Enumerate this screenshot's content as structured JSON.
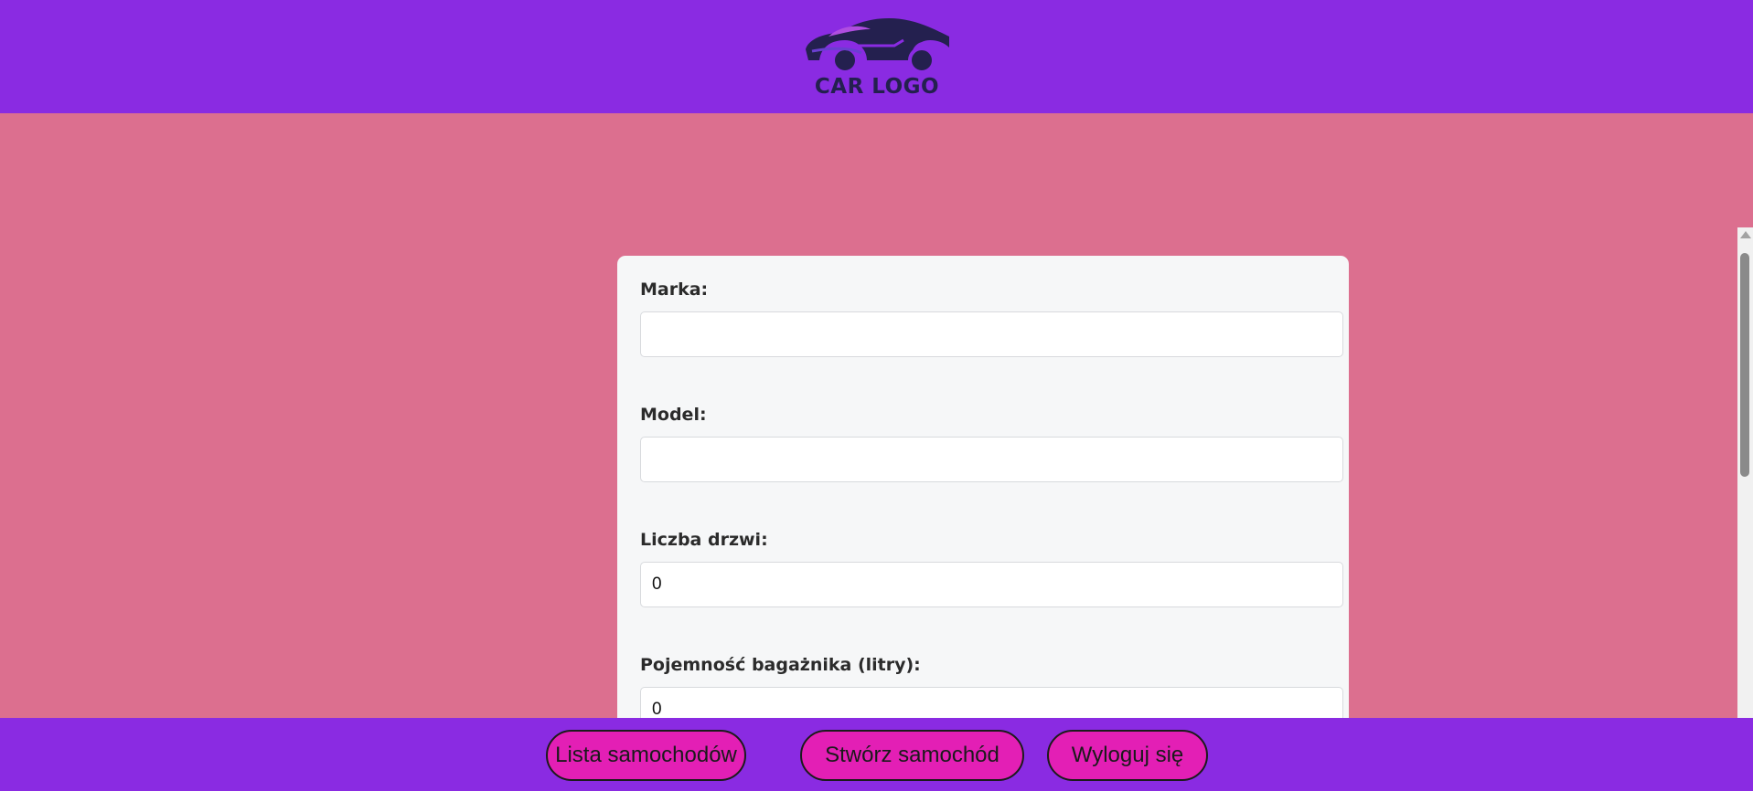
{
  "colors": {
    "header_bg": "#8a2be2",
    "page_bg": "#dc6f8f",
    "card_bg": "#f6f7f8",
    "button_bg": "#e31fb5",
    "logo_color": "#24204f"
  },
  "header": {
    "logo_icon": "car-silhouette-icon",
    "logo_text": "CAR LOGO"
  },
  "form": {
    "fields": [
      {
        "label": "Marka:",
        "value": ""
      },
      {
        "label": "Model:",
        "value": ""
      },
      {
        "label": "Liczba drzwi:",
        "value": "0"
      },
      {
        "label": "Pojemność bagażnika (litry):",
        "value": "0"
      }
    ]
  },
  "footer": {
    "buttons": [
      {
        "label": "Lista samochodów"
      },
      {
        "label": "Stwórz samochód"
      },
      {
        "label": "Wyloguj się"
      }
    ]
  }
}
